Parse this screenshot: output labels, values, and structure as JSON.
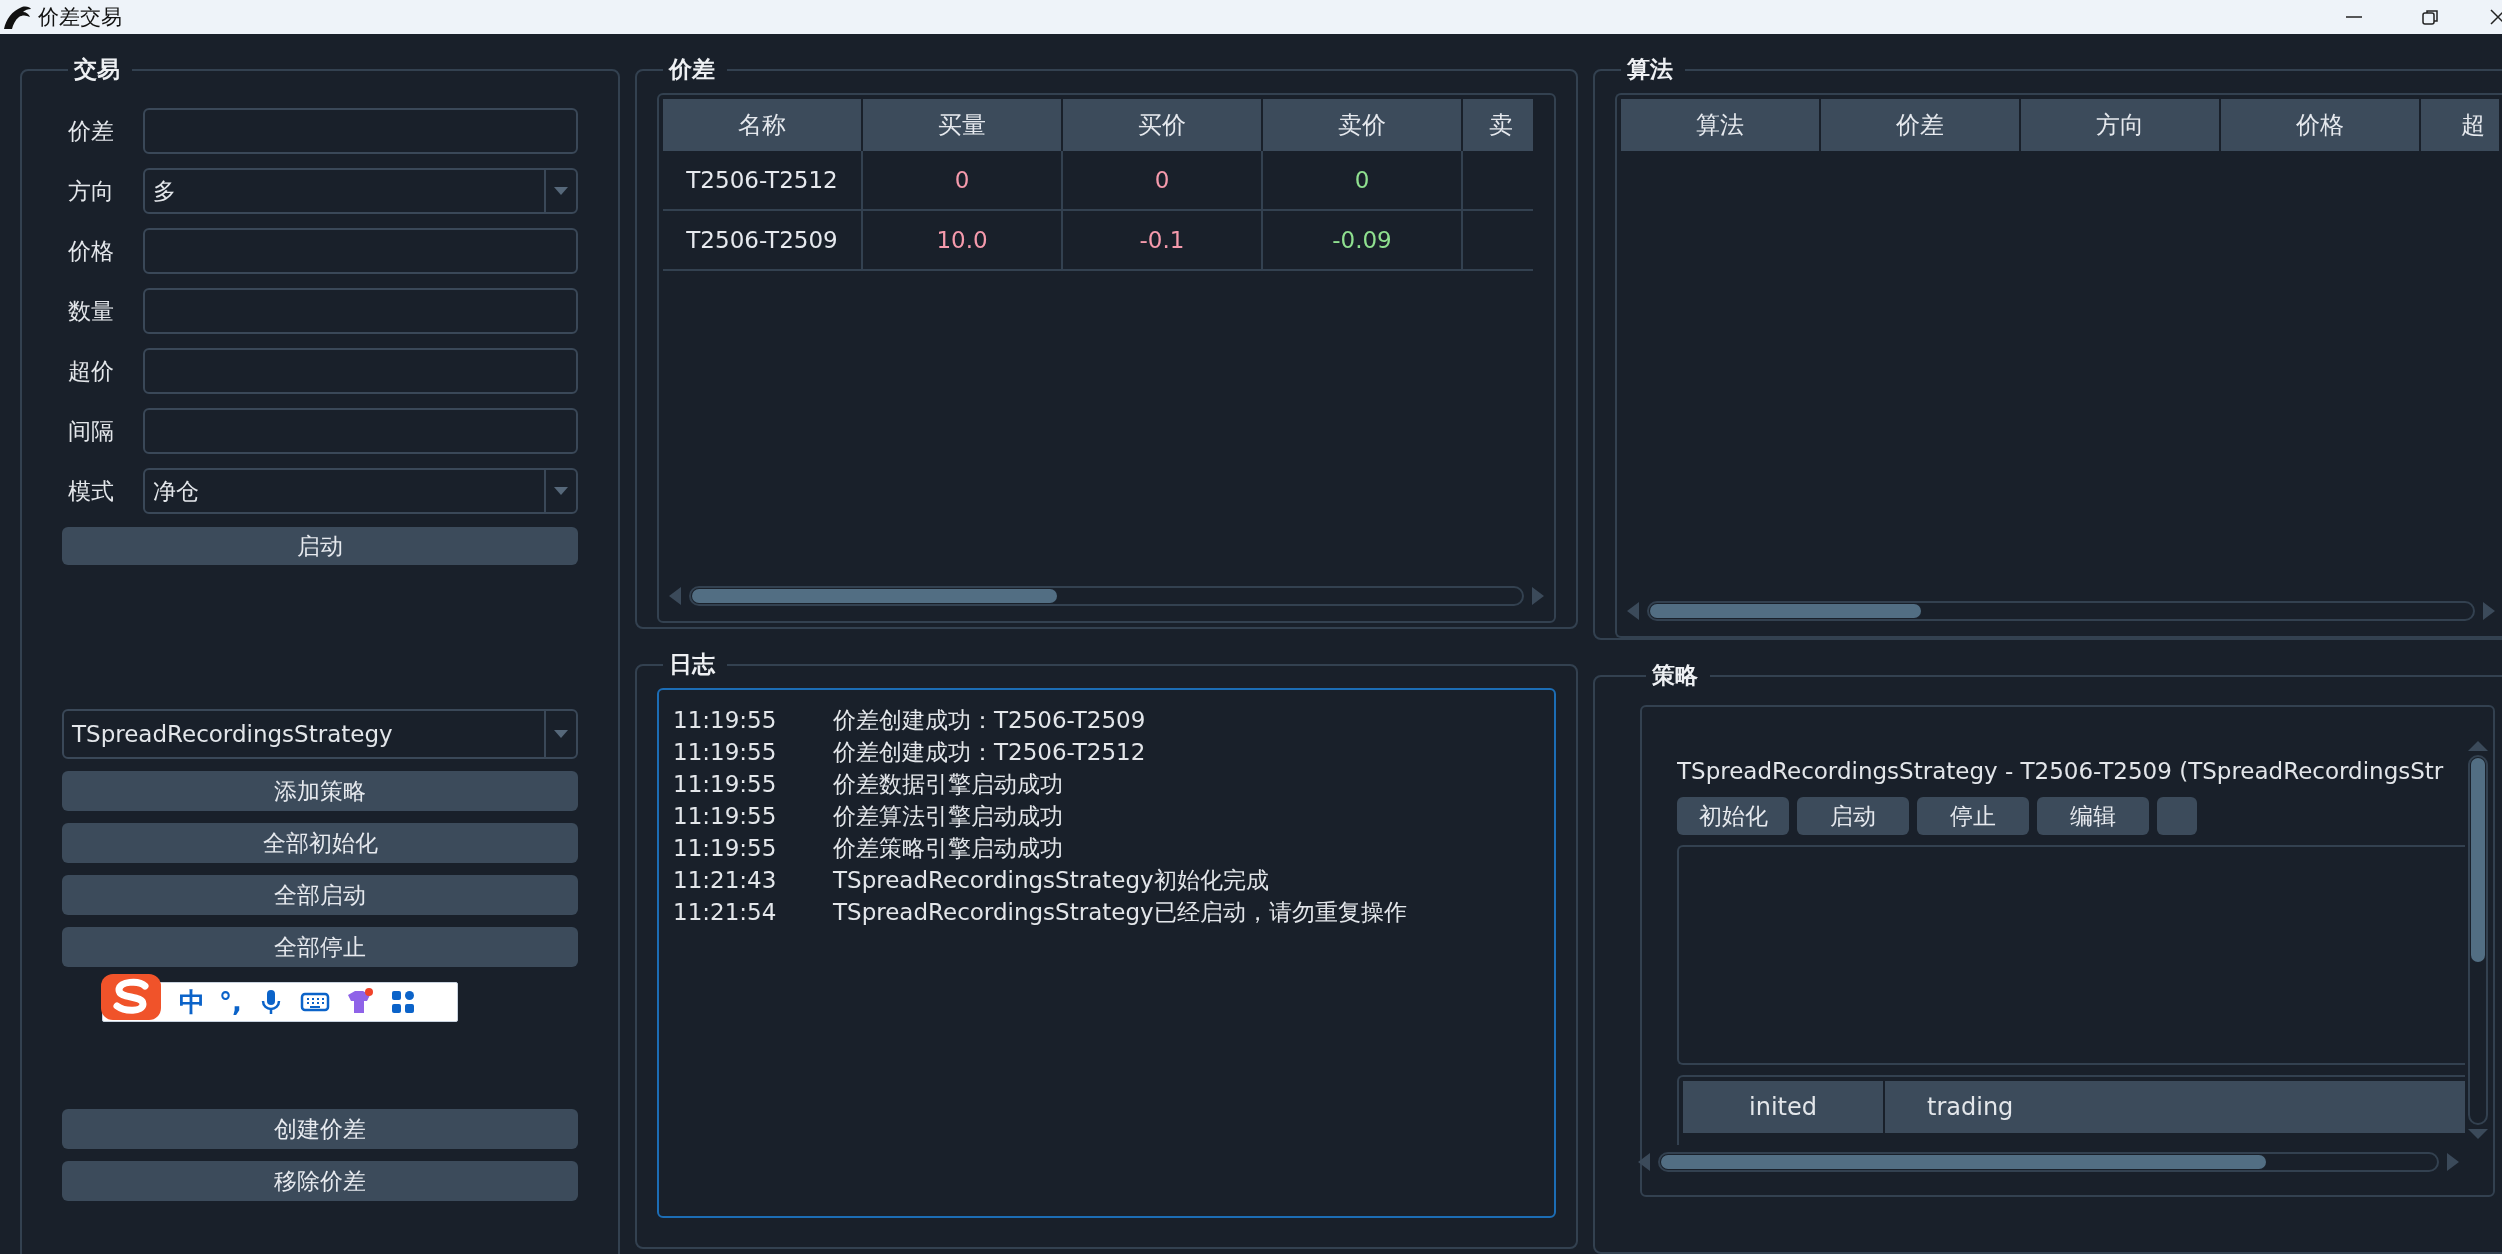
{
  "window": {
    "title": "价差交易"
  },
  "ime_toolbar": {
    "mode": "中",
    "punctuation": "°,"
  },
  "trade": {
    "title": "交易",
    "fields": [
      {
        "label": "价差",
        "kind": "text"
      },
      {
        "label": "方向",
        "kind": "combo",
        "value": "多"
      },
      {
        "label": "价格",
        "kind": "text"
      },
      {
        "label": "数量",
        "kind": "text"
      },
      {
        "label": "超价",
        "kind": "text"
      },
      {
        "label": "间隔",
        "kind": "text"
      },
      {
        "label": "模式",
        "kind": "combo",
        "value": "净仓"
      }
    ],
    "start_button": "启动",
    "strategy_combo": {
      "value": "TSpreadRecordingsStrategy"
    },
    "strategy_buttons": [
      "添加策略",
      "全部初始化",
      "全部启动",
      "全部停止"
    ],
    "spread_buttons": [
      "创建价差",
      "移除价差"
    ]
  },
  "spread": {
    "title": "价差",
    "columns": [
      {
        "label": "名称",
        "kind": "name"
      },
      {
        "label": "买量",
        "kind": "bid"
      },
      {
        "label": "买价",
        "kind": "bid"
      },
      {
        "label": "卖价",
        "kind": "ask"
      },
      {
        "label": "卖",
        "kind": "ask"
      }
    ],
    "rows": [
      [
        "T2506-T2512",
        "0",
        "0",
        "0"
      ],
      [
        "T2506-T2509",
        "10.0",
        "-0.1",
        "-0.09"
      ]
    ]
  },
  "algo": {
    "title": "算法",
    "columns": [
      "算法",
      "价差",
      "方向",
      "价格",
      "超"
    ]
  },
  "log": {
    "title": "日志",
    "entries": [
      {
        "time": "11:19:55",
        "message": "价差创建成功：T2506-T2509"
      },
      {
        "time": "11:19:55",
        "message": "价差创建成功：T2506-T2512"
      },
      {
        "time": "11:19:55",
        "message": "价差数据引擎启动成功"
      },
      {
        "time": "11:19:55",
        "message": "价差算法引擎启动成功"
      },
      {
        "time": "11:19:55",
        "message": "价差策略引擎启动成功"
      },
      {
        "time": "11:21:43",
        "message": "TSpreadRecordingsStrategy初始化完成"
      },
      {
        "time": "11:21:54",
        "message": "TSpreadRecordingsStrategy已经启动，请勿重复操作"
      }
    ]
  },
  "strategy": {
    "title": "策略",
    "card": {
      "label": "TSpreadRecordingsStrategy  -  T2506-T2509  (TSpreadRecordingsStr",
      "buttons": [
        "初始化",
        "启动",
        "停止",
        "编辑"
      ],
      "columns": [
        "inited",
        "trading"
      ]
    }
  }
}
